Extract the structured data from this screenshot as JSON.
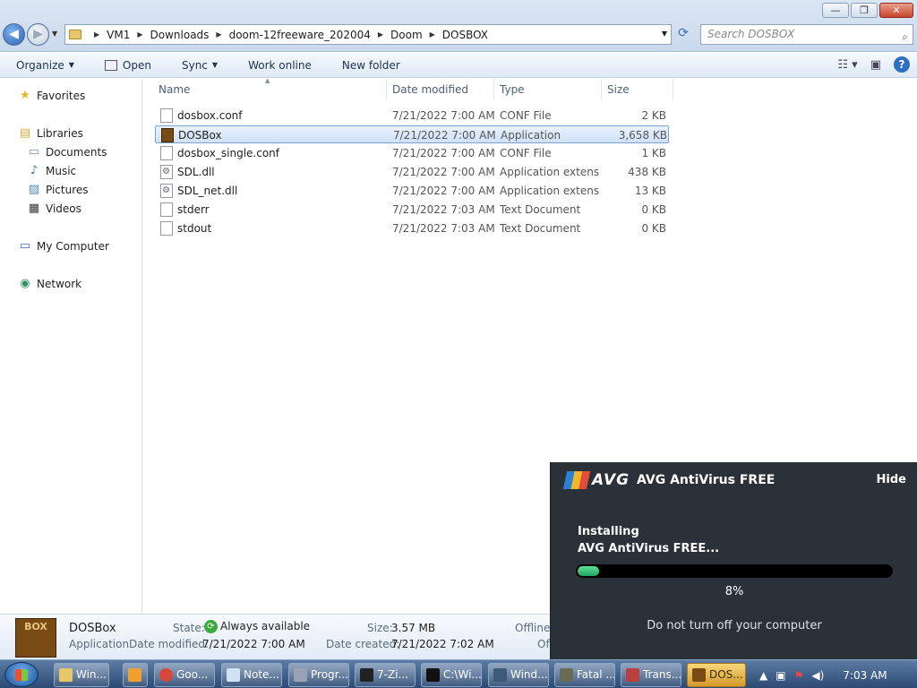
{
  "window": {
    "minimize": "—",
    "restore": "❐",
    "close": "✕"
  },
  "address": {
    "crumbs": [
      "VM1",
      "Downloads",
      "doom-12freeware_202004",
      "Doom",
      "DOSBOX"
    ],
    "search_placeholder": "Search DOSBOX"
  },
  "toolbar": {
    "organize": "Organize",
    "open": "Open",
    "sync": "Sync",
    "work_online": "Work online",
    "new_folder": "New folder"
  },
  "nav": {
    "favorites": "Favorites",
    "libraries": "Libraries",
    "documents": "Documents",
    "music": "Music",
    "pictures": "Pictures",
    "videos": "Videos",
    "my_computer": "My Computer",
    "network": "Network"
  },
  "columns": {
    "name": "Name",
    "date": "Date modified",
    "type": "Type",
    "size": "Size"
  },
  "files": [
    {
      "name": "dosbox.conf",
      "date": "7/21/2022 7:00 AM",
      "type": "CONF File",
      "size": "2 KB"
    },
    {
      "name": "DOSBox",
      "date": "7/21/2022 7:00 AM",
      "type": "Application",
      "size": "3,658 KB"
    },
    {
      "name": "dosbox_single.conf",
      "date": "7/21/2022 7:00 AM",
      "type": "CONF File",
      "size": "1 KB"
    },
    {
      "name": "SDL.dll",
      "date": "7/21/2022 7:00 AM",
      "type": "Application extens...",
      "size": "438 KB"
    },
    {
      "name": "SDL_net.dll",
      "date": "7/21/2022 7:00 AM",
      "type": "Application extens...",
      "size": "13 KB"
    },
    {
      "name": "stderr",
      "date": "7/21/2022 7:03 AM",
      "type": "Text Document",
      "size": "0 KB"
    },
    {
      "name": "stdout",
      "date": "7/21/2022 7:03 AM",
      "type": "Text Document",
      "size": "0 KB"
    }
  ],
  "details": {
    "icon_text": "BOX",
    "name": "DOSBox",
    "kind": "Application",
    "state_label": "State:",
    "state_value": "Always available",
    "modified_label": "Date modified:",
    "modified_value": "7/21/2022 7:00 AM",
    "size_label": "Size:",
    "size_value": "3.57 MB",
    "created_label": "Date created:",
    "created_value": "7/21/2022 7:02 AM",
    "offline": "Offline",
    "offline_cut": "Of"
  },
  "avg": {
    "logo": "AVG",
    "title": "AVG AntiVirus FREE",
    "hide": "Hide",
    "status_line1": "Installing",
    "status_line2": "AVG AntiVirus FREE...",
    "progress": 8,
    "progress_label": "8%",
    "warning": "Do not turn off your computer"
  },
  "taskbar": {
    "tasks": [
      {
        "label": "Win...",
        "color": "#e8c66a"
      },
      {
        "label": "",
        "color": "#f0a030"
      },
      {
        "label": "Goo...",
        "color": "#d9473b"
      },
      {
        "label": "Note...",
        "color": "#cfe1f5"
      },
      {
        "label": "Progr...",
        "color": "#9aa3b5"
      },
      {
        "label": "7-Zi...",
        "color": "#222222"
      },
      {
        "label": "C:\\Wi...",
        "color": "#111111"
      },
      {
        "label": "Wind...",
        "color": "#3c5a7a"
      },
      {
        "label": "Fatal ...",
        "color": "#6b6b55"
      },
      {
        "label": "Trans...",
        "color": "#b84040"
      },
      {
        "label": "DOS...",
        "color": "#7a4a14"
      }
    ],
    "clock": "7:03 AM"
  },
  "colors": {
    "accent": "#2f6ec3",
    "avg_bg": "#2b3138",
    "progress": "#1fa45e"
  }
}
